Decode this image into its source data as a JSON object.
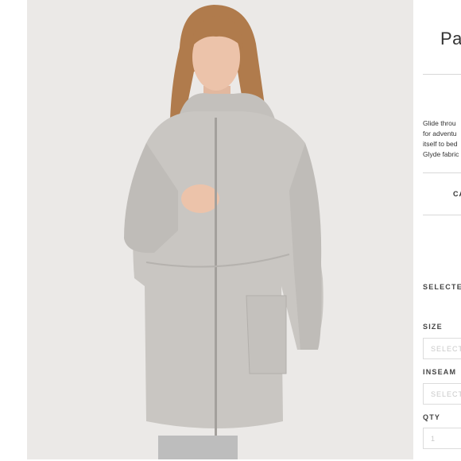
{
  "product": {
    "title": "Pac",
    "description_lines": [
      "Glide throu",
      "for adventu",
      "itself to bed",
      "Glyde fabric"
    ],
    "cart_label": "CA",
    "selected_label": "SELECTEI",
    "size": {
      "label": "SIZE",
      "placeholder": "SELECT"
    },
    "inseam": {
      "label": "INSEAM",
      "placeholder": "SELECT"
    },
    "qty": {
      "label": "QTY",
      "value": "1"
    }
  },
  "image": {
    "subject": "model wearing light grey hooded zip-up jacket",
    "background_color": "#ebe9e7",
    "jacket_color": "#c9c6c2"
  }
}
